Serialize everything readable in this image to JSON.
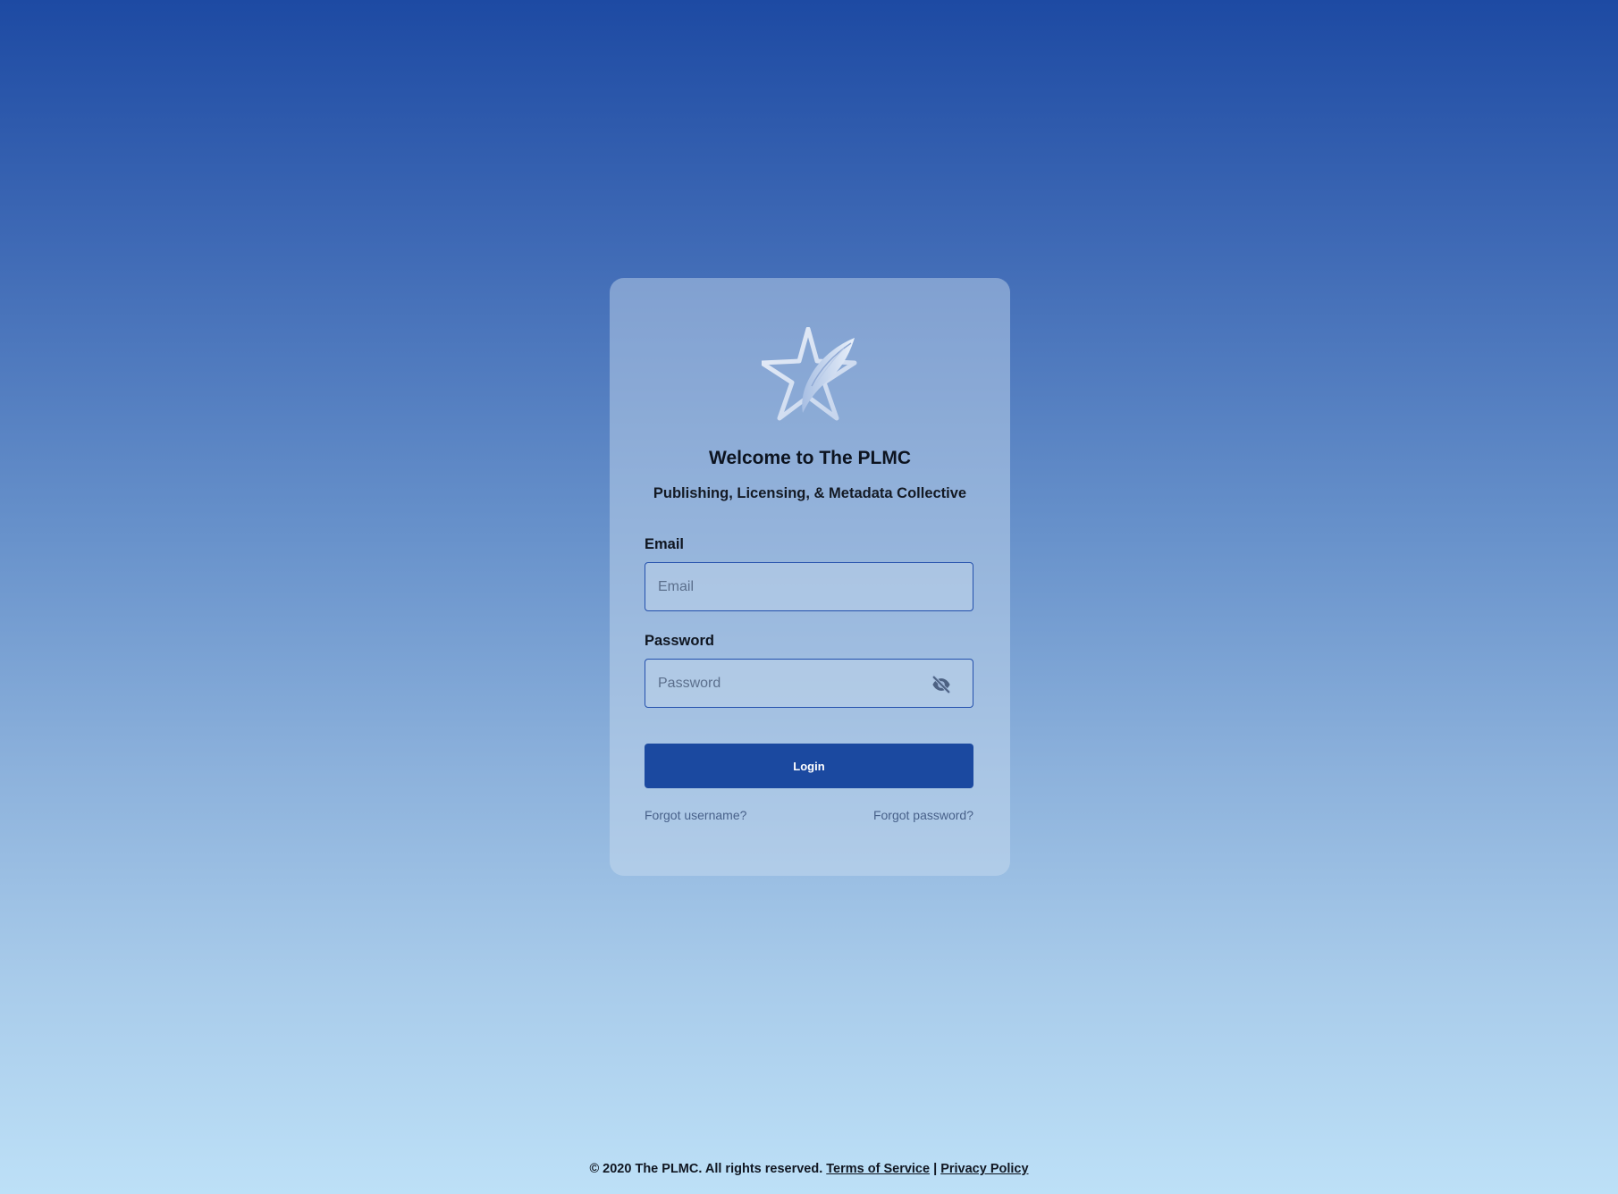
{
  "card": {
    "title": "Welcome to The PLMC",
    "subtitle": "Publishing, Licensing, & Metadata Collective",
    "logo_icon": "star-feather-logo"
  },
  "form": {
    "email_label": "Email",
    "email_placeholder": "Email",
    "email_value": "",
    "password_label": "Password",
    "password_placeholder": "Password",
    "password_value": "",
    "password_toggle_icon": "eye-off-icon",
    "login_label": "Login",
    "forgot_username": "Forgot username?",
    "forgot_password": "Forgot password?"
  },
  "footer": {
    "copyright": "© 2020 The PLMC. All rights reserved.",
    "terms": "Terms of Service",
    "separator": "|",
    "privacy": "Privacy Policy"
  },
  "colors": {
    "primary": "#1b49a0",
    "field_border": "#2450ac",
    "link": "#48618a"
  }
}
